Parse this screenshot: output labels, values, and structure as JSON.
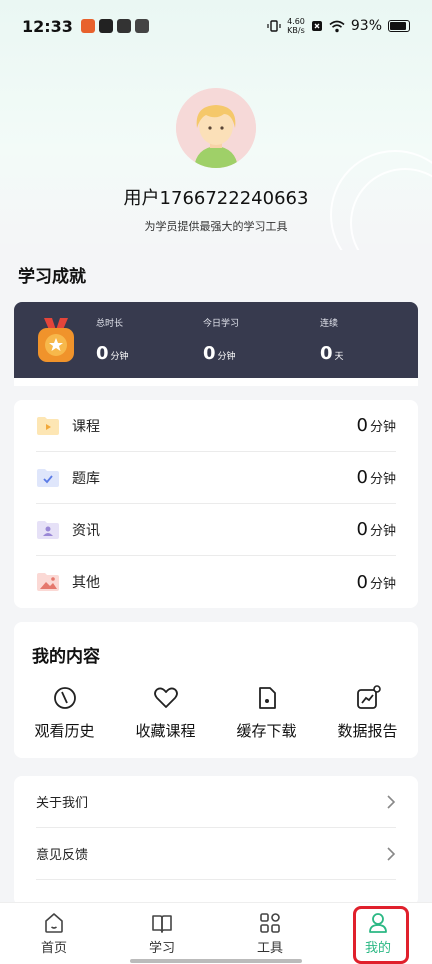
{
  "status_bar": {
    "time": "12:33",
    "net_speed_value": "4.60",
    "net_speed_unit": "KB/s",
    "battery": "93%"
  },
  "profile": {
    "username": "用户17667222406​63",
    "slogan": "为学员提供最强大的学习工具"
  },
  "achievements": {
    "title": "学习成就",
    "stats": [
      {
        "label": "总时长",
        "value": "0",
        "unit": "分钟"
      },
      {
        "label": "今日学习",
        "value": "0",
        "unit": "分钟"
      },
      {
        "label": "连续",
        "value": "0",
        "unit": "天"
      }
    ],
    "rows": [
      {
        "name": "课程",
        "value": "0",
        "unit": "分钟",
        "icon": "video-folder-icon"
      },
      {
        "name": "题库",
        "value": "0",
        "unit": "分钟",
        "icon": "check-folder-icon"
      },
      {
        "name": "资讯",
        "value": "0",
        "unit": "分钟",
        "icon": "person-folder-icon"
      },
      {
        "name": "其他",
        "value": "0",
        "unit": "分钟",
        "icon": "image-folder-icon"
      }
    ]
  },
  "my_content": {
    "title": "我的内容",
    "items": [
      {
        "label": "观看历史",
        "icon": "history-icon"
      },
      {
        "label": "收藏课程",
        "icon": "heart-icon"
      },
      {
        "label": "缓存下载",
        "icon": "download-icon"
      },
      {
        "label": "数据报告",
        "icon": "chart-icon"
      }
    ]
  },
  "settings": {
    "items": [
      {
        "label": "关于我们"
      },
      {
        "label": "意见反馈"
      }
    ]
  },
  "tabbar": {
    "tabs": [
      {
        "label": "首页",
        "icon": "home-icon",
        "active": false
      },
      {
        "label": "学习",
        "icon": "book-icon",
        "active": false
      },
      {
        "label": "工具",
        "icon": "grid-icon",
        "active": false
      },
      {
        "label": "我的",
        "icon": "user-icon",
        "active": true
      }
    ]
  },
  "colors": {
    "accent": "#2bb884",
    "dark_card": "#373a4e",
    "highlight": "#e0202c"
  }
}
